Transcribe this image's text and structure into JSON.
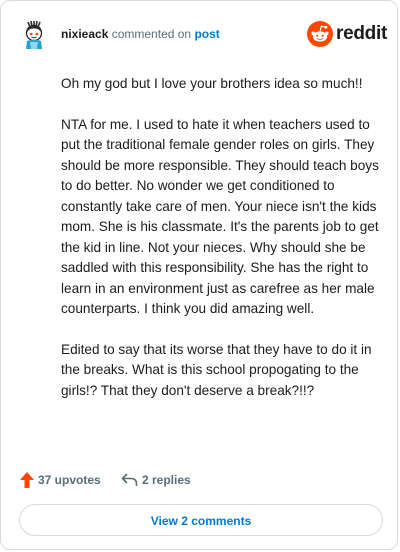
{
  "comment": {
    "author": "nixieack",
    "action": "commented on",
    "target": "post",
    "brand": "reddit",
    "paragraphs": [
      "Oh my god but I love your brothers idea so much!!",
      "NTA for me. I used to hate it when teachers used to put the traditional female gender roles on girls. They should be more responsible. They should teach boys to do better. No wonder we get conditioned to constantly take care of men. Your niece isn't the kids mom. She is his classmate. It's the parents job to get the kid in line. Not your nieces. Why should she be saddled with this responsibility. She has the right to learn in an environment just as carefree as her male counterparts. I think you did amazing well.",
      "Edited to say that its worse that they have to do it in the breaks. What is this school propogating to the girls!? That they don't deserve a break?!!?"
    ]
  },
  "footer": {
    "upvotes_label": "37 upvotes",
    "replies_label": "2 replies",
    "view_comments_label": "View 2 comments"
  },
  "icons": {
    "avatar": "snoo-avatar-icon",
    "brand": "reddit-logo-icon",
    "upvote": "upvote-arrow-icon",
    "reply": "reply-arrow-icon"
  },
  "colors": {
    "brand_orange": "#ff4500",
    "link_blue": "#0079d3",
    "meta_gray": "#576f76"
  }
}
